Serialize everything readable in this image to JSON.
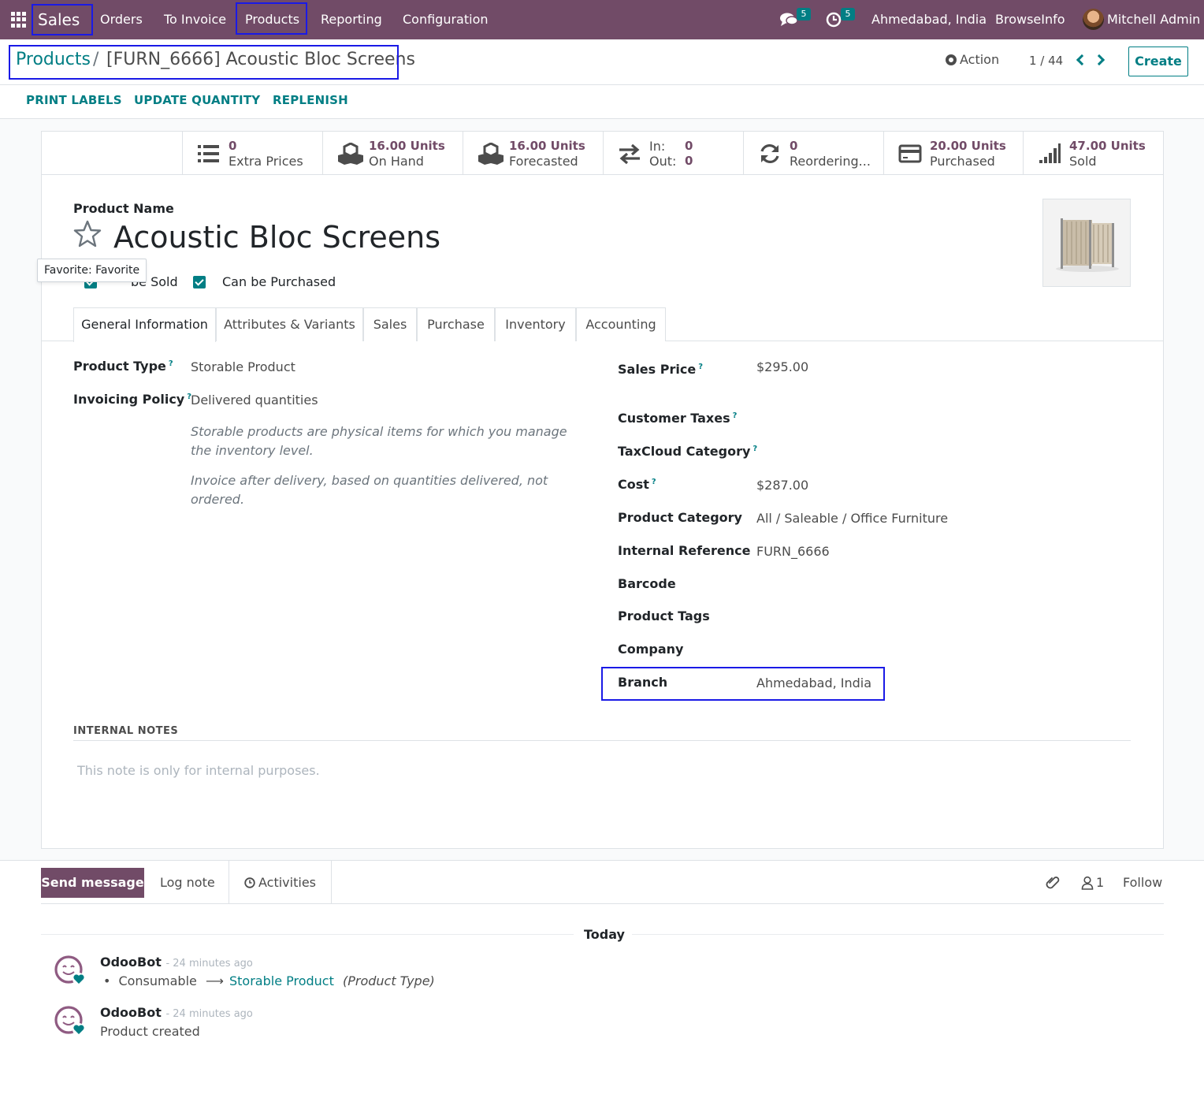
{
  "navbar": {
    "app_name": "Sales",
    "menu": [
      "Orders",
      "To Invoice",
      "Products",
      "Reporting",
      "Configuration"
    ],
    "messages_badge": "5",
    "activities_badge": "5",
    "branch": "Ahmedabad, India",
    "company": "BrowseInfo",
    "user": "Mitchell Admin"
  },
  "breadcrumb": {
    "parent": "Products",
    "separator": "/",
    "current": "[FURN_6666] Acoustic Bloc Screens"
  },
  "control": {
    "action_label": "Action",
    "pager": "1 / 44",
    "create_label": "Create"
  },
  "header_buttons": [
    "PRINT LABELS",
    "UPDATE QUANTITY",
    "REPLENISH"
  ],
  "stats": {
    "extra_prices": {
      "value": "0",
      "label": "Extra Prices"
    },
    "on_hand": {
      "value": "16.00 Units",
      "label": "On Hand"
    },
    "forecasted": {
      "value": "16.00 Units",
      "label": "Forecasted"
    },
    "in_out": {
      "in_label": "In:",
      "in_value": "0",
      "out_label": "Out:",
      "out_value": "0"
    },
    "reordering": {
      "value": "0",
      "label": "Reordering..."
    },
    "purchased": {
      "value": "20.00 Units",
      "label": "Purchased"
    },
    "sold": {
      "value": "47.00 Units",
      "label": "Sold"
    }
  },
  "product": {
    "name_label": "Product Name",
    "name": "Acoustic Bloc Screens",
    "favorite_tooltip": "Favorite: Favorite",
    "can_be_sold_label": "Can be Sold",
    "can_be_sold_visible": "be Sold",
    "can_be_purchased_label": "Can be Purchased"
  },
  "tabs": [
    "General Information",
    "Attributes & Variants",
    "Sales",
    "Purchase",
    "Inventory",
    "Accounting"
  ],
  "general_left": {
    "product_type_label": "Product Type",
    "product_type": "Storable Product",
    "invoicing_policy_label": "Invoicing Policy",
    "invoicing_policy": "Delivered quantities",
    "help_storable": "Storable products are physical items for which you manage the inventory level.",
    "help_invoice": "Invoice after delivery, based on quantities delivered, not ordered."
  },
  "general_right": {
    "sales_price_label": "Sales Price",
    "sales_price": "$295.00",
    "customer_taxes_label": "Customer Taxes",
    "taxcloud_label": "TaxCloud Category",
    "cost_label": "Cost",
    "cost": "$287.00",
    "category_label": "Product Category",
    "category": "All / Saleable / Office Furniture",
    "internal_ref_label": "Internal Reference",
    "internal_ref": "FURN_6666",
    "barcode_label": "Barcode",
    "tags_label": "Product Tags",
    "company_label": "Company",
    "branch_label": "Branch",
    "branch": "Ahmedabad, India"
  },
  "notes": {
    "title": "INTERNAL NOTES",
    "placeholder": "This note is only for internal purposes."
  },
  "chatter": {
    "send_message": "Send message",
    "log_note": "Log note",
    "activities": "Activities",
    "followers_count": "1",
    "follow": "Follow",
    "today": "Today",
    "messages": [
      {
        "author": "OdooBot",
        "ago": "- 24 minutes ago",
        "old": "Consumable",
        "new": "Storable Product",
        "field": "(Product Type)"
      },
      {
        "author": "OdooBot",
        "ago": "- 24 minutes ago",
        "body": "Product created"
      }
    ]
  },
  "colors": {
    "brand": "#714B67",
    "accent": "#017e84",
    "highlight": "#1a1ae6"
  }
}
